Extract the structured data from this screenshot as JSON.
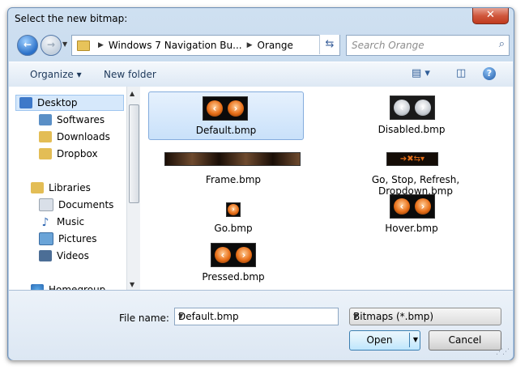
{
  "window": {
    "title": "Select the new bitmap:",
    "close_glyph": "✕"
  },
  "nav": {
    "back_glyph": "←",
    "forward_glyph": "→",
    "history_glyph": "▼"
  },
  "address": {
    "segments": [
      "Windows 7 Navigation Bu...",
      "Orange"
    ],
    "separator_glyph": "▶",
    "refresh_glyph": "⇆"
  },
  "search": {
    "placeholder": "Search Orange",
    "icon_glyph": "⌕"
  },
  "toolbar": {
    "organize": "Organize ▾",
    "new_folder": "New folder",
    "view_glyph": "▤ ▾",
    "pane_glyph": "◫",
    "help_glyph": "?"
  },
  "sidebar": {
    "items": [
      {
        "label": "Desktop",
        "icon": "desktop-icon",
        "selected": true
      },
      {
        "label": "Softwares",
        "icon": "softwares-icon"
      },
      {
        "label": "Downloads",
        "icon": "downloads-icon"
      },
      {
        "label": "Dropbox",
        "icon": "dropbox-icon"
      },
      {
        "label": "Libraries",
        "icon": "libraries-icon"
      },
      {
        "label": "Documents",
        "icon": "documents-icon"
      },
      {
        "label": "Music",
        "icon": "music-icon"
      },
      {
        "label": "Pictures",
        "icon": "pictures-icon"
      },
      {
        "label": "Videos",
        "icon": "videos-icon"
      },
      {
        "label": "Homegroup",
        "icon": "homegroup-icon"
      }
    ]
  },
  "files": [
    {
      "name": "Default.bmp",
      "selected": true
    },
    {
      "name": "Disabled.bmp"
    },
    {
      "name": "Frame.bmp"
    },
    {
      "name": "Go, Stop, Refresh, Dropdown.bmp"
    },
    {
      "name": "Go.bmp"
    },
    {
      "name": "Hover.bmp"
    },
    {
      "name": "Pressed.bmp"
    }
  ],
  "footer": {
    "file_name_label": "File name:",
    "file_name_value": "Default.bmp",
    "file_type_value": "Bitmaps (*.bmp)",
    "open_label": "Open",
    "cancel_label": "Cancel",
    "dropdown_glyph": "▼"
  }
}
